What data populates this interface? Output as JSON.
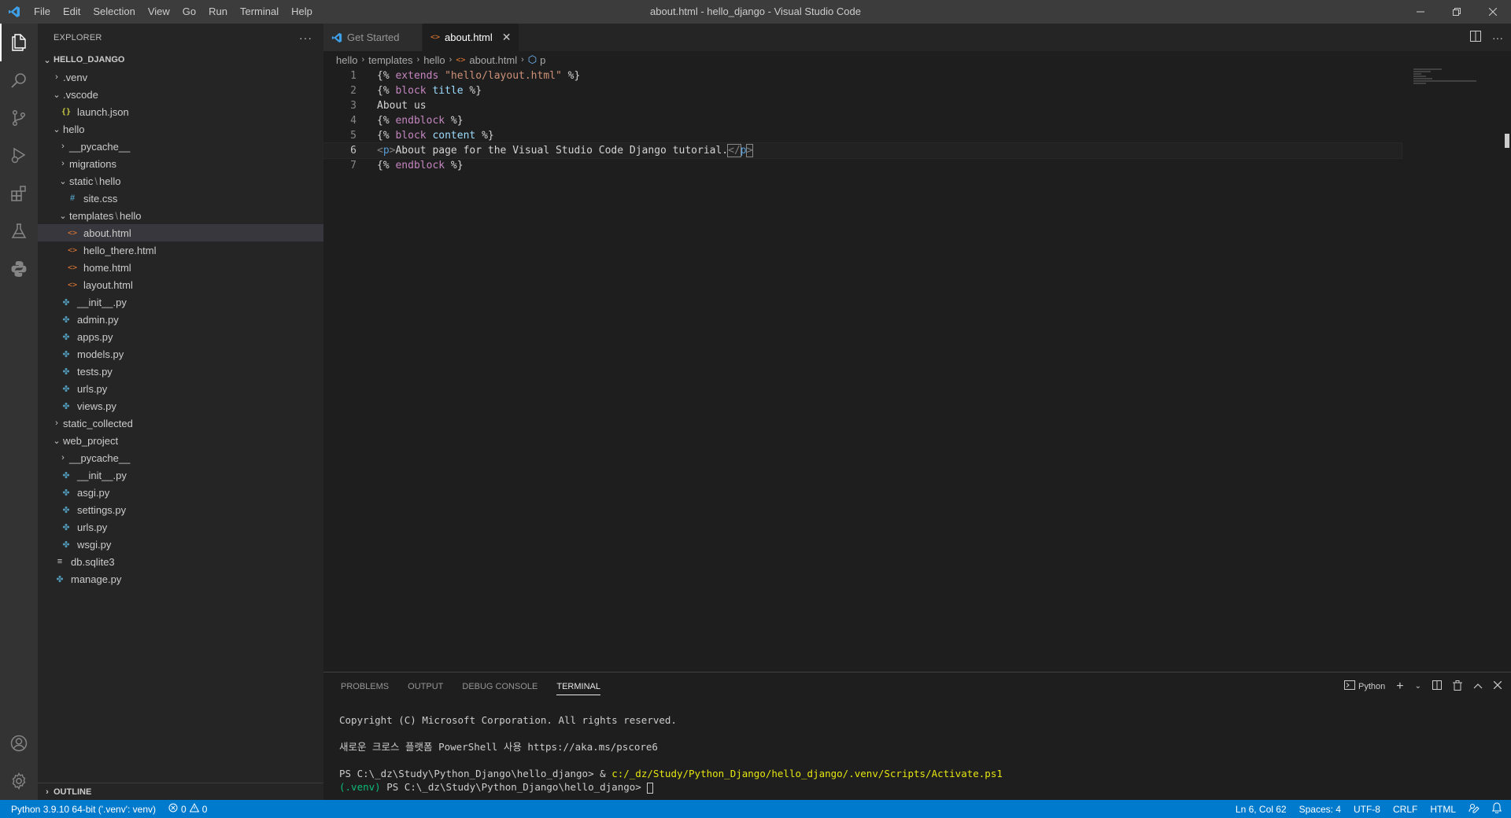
{
  "window": {
    "title": "about.html - hello_django - Visual Studio Code",
    "menu": [
      "File",
      "Edit",
      "Selection",
      "View",
      "Go",
      "Run",
      "Terminal",
      "Help"
    ]
  },
  "explorer": {
    "title": "EXPLORER",
    "project": "HELLO_DJANGO",
    "items": [
      {
        "label": ".venv",
        "type": "folder",
        "expanded": false
      },
      {
        "label": ".vscode",
        "type": "folder",
        "expanded": true
      },
      {
        "label": "launch.json",
        "type": "json"
      },
      {
        "label": "hello",
        "type": "folder",
        "expanded": true
      },
      {
        "label": "__pycache__",
        "type": "folder",
        "expanded": false
      },
      {
        "label": "migrations",
        "type": "folder",
        "expanded": false
      },
      {
        "label": "static",
        "label2": "hello",
        "type": "folder",
        "expanded": true
      },
      {
        "label": "site.css",
        "type": "css"
      },
      {
        "label": "templates",
        "label2": "hello",
        "type": "folder",
        "expanded": true
      },
      {
        "label": "about.html",
        "type": "html"
      },
      {
        "label": "hello_there.html",
        "type": "html"
      },
      {
        "label": "home.html",
        "type": "html"
      },
      {
        "label": "layout.html",
        "type": "html"
      },
      {
        "label": "__init__.py",
        "type": "py"
      },
      {
        "label": "admin.py",
        "type": "py"
      },
      {
        "label": "apps.py",
        "type": "py"
      },
      {
        "label": "models.py",
        "type": "py"
      },
      {
        "label": "tests.py",
        "type": "py"
      },
      {
        "label": "urls.py",
        "type": "py"
      },
      {
        "label": "views.py",
        "type": "py"
      },
      {
        "label": "static_collected",
        "type": "folder",
        "expanded": false
      },
      {
        "label": "web_project",
        "type": "folder",
        "expanded": true
      },
      {
        "label": "__pycache__",
        "type": "folder",
        "expanded": false
      },
      {
        "label": "__init__.py",
        "type": "py"
      },
      {
        "label": "asgi.py",
        "type": "py"
      },
      {
        "label": "settings.py",
        "type": "py"
      },
      {
        "label": "urls.py",
        "type": "py"
      },
      {
        "label": "wsgi.py",
        "type": "py"
      },
      {
        "label": "db.sqlite3",
        "type": "db"
      },
      {
        "label": "manage.py",
        "type": "py"
      }
    ],
    "outline": "OUTLINE"
  },
  "tabs": {
    "get_started": "Get Started",
    "active": "about.html"
  },
  "breadcrumb": [
    "hello",
    "templates",
    "hello",
    "about.html",
    "p"
  ],
  "editor": {
    "line_numbers": [
      "1",
      "2",
      "3",
      "4",
      "5",
      "6",
      "7"
    ],
    "lines": {
      "l1": {
        "open": "{% ",
        "kw": "extends",
        "str": "\"hello/layout.html\"",
        "close": " %}"
      },
      "l2": {
        "open": "{% ",
        "kw": "block",
        "ident": "title",
        "close": " %}"
      },
      "l3": {
        "text": "About us"
      },
      "l4": {
        "open": "{% ",
        "kw": "endblock",
        "close": " %}"
      },
      "l5": {
        "open": "{% ",
        "kw": "block",
        "ident": "content",
        "close": " %}"
      },
      "l6": {
        "tag_open_l": "<",
        "tag_name": "p",
        "tag_open_r": ">",
        "text": "About page for the Visual Studio Code Django tutorial.",
        "tag_close_l": "</",
        "tag_close_name": "p",
        "tag_close_r": ">"
      },
      "l7": {
        "open": "{% ",
        "kw": "endblock",
        "close": " %}"
      }
    }
  },
  "panel": {
    "tabs": [
      "PROBLEMS",
      "OUTPUT",
      "DEBUG CONSOLE",
      "TERMINAL"
    ],
    "terminal_name": "Python",
    "terminal": {
      "line1": "Copyright (C) Microsoft Corporation. All rights reserved.",
      "line2": "새로운 크로스 플랫폼 PowerShell 사용 https://aka.ms/pscore6",
      "line3_prompt": "PS C:\\_dz\\Study\\Python_Django\\hello_django> & ",
      "line3_cmd": "c:/_dz/Study/Python_Django/hello_django/.venv/Scripts/Activate.ps1",
      "line4_venv": "(.venv)",
      "line4_prompt": " PS C:\\_dz\\Study\\Python_Django\\hello_django> "
    }
  },
  "statusbar": {
    "interpreter": "Python 3.9.10 64-bit ('.venv': venv)",
    "errors": "0",
    "warnings": "0",
    "position": "Ln 6, Col 62",
    "spaces": "Spaces: 4",
    "encoding": "UTF-8",
    "eol": "CRLF",
    "language": "HTML"
  },
  "colors": {
    "accent": "#007acc",
    "titlebar": "#3c3c3c",
    "activitybar": "#333333",
    "sidebar": "#252526",
    "editor": "#1e1e1e"
  }
}
